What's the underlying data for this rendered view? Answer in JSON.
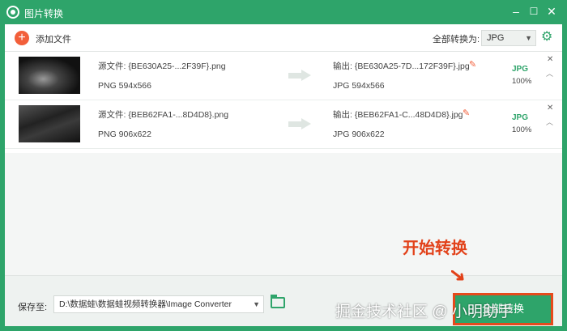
{
  "window": {
    "title": "图片转换"
  },
  "toolbar": {
    "add_label": "添加文件",
    "convert_all_label": "全部转换为:",
    "format_selected": "JPG"
  },
  "files": [
    {
      "src_label": "源文件: {BE630A25-...2F39F}.png",
      "src_meta": "PNG   594x566",
      "out_label": "输出: {BE630A25-7D...172F39F}.jpg",
      "out_meta": "JPG   594x566",
      "format": "JPG",
      "progress": "100%"
    },
    {
      "src_label": "源文件: {BEB62FA1-...8D4D8}.png",
      "src_meta": "PNG   906x622",
      "out_label": "输出: {BEB62FA1-C...48D4D8}.jpg",
      "out_meta": "JPG   906x622",
      "format": "JPG",
      "progress": "100%"
    }
  ],
  "bottom": {
    "save_label": "保存至:",
    "save_path": "D:\\数据蛙\\数据蛙视频转换器\\Image Converter",
    "convert_button": "全部转换"
  },
  "annotation": {
    "text": "开始转换"
  },
  "watermark": {
    "text": "掘金技术社区 @ 小明助手"
  },
  "colors": {
    "accent": "#2ea46a",
    "highlight": "#e64a1c",
    "add": "#f25f3a"
  }
}
